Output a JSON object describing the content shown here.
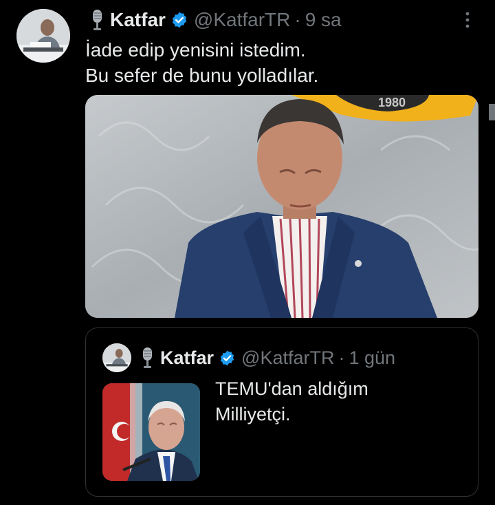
{
  "tweet": {
    "author": {
      "name": "Katfar",
      "handle": "@KatfarTR",
      "separator": "·",
      "time": "9 sa",
      "avatar_icon": "user-avatar",
      "emoji_icon": "microphone-icon",
      "verified_icon": "verified-badge-icon"
    },
    "text_lines": [
      "İade edip yenisini istedim.",
      "Bu sefer de bunu yolladılar."
    ],
    "media_badge_text": "1980",
    "more_icon": "more-options-icon"
  },
  "quote": {
    "author": {
      "name": "Katfar",
      "handle": "@KatfarTR",
      "separator": "·",
      "time": "1 gün"
    },
    "text_lines": [
      "TEMU'dan aldığım",
      "Milliyetçi."
    ]
  },
  "colors": {
    "background": "#000000",
    "text": "#e7e9ea",
    "secondary": "#71767b",
    "verified": "#1d9bf0",
    "border": "#2f3336"
  }
}
